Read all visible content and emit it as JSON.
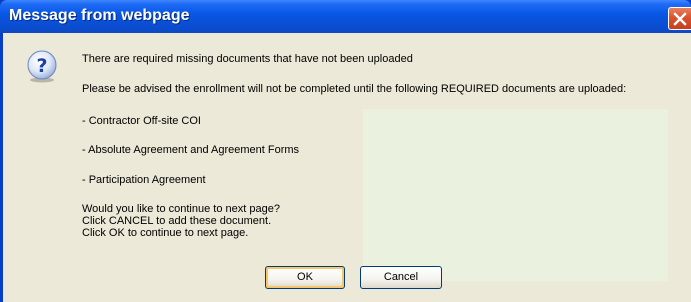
{
  "window": {
    "title": "Message from webpage",
    "close_icon": "close-icon"
  },
  "dialog": {
    "icon": "question-icon",
    "line1": "There are required missing documents that have not been uploaded",
    "line2": "Please be advised the enrollment will not be completed until the following REQUIRED documents are uploaded:",
    "documents": [
      "- Contractor Off-site COI",
      "- Absolute Agreement and Agreement Forms",
      "- Participation Agreement"
    ],
    "prompt": [
      "Would you like to continue to next page?",
      "Click CANCEL to add these document.",
      "Click OK to continue to next page."
    ]
  },
  "buttons": {
    "ok_label": "OK",
    "cancel_label": "Cancel"
  },
  "colors": {
    "titlebar": "#0858e6",
    "client_background": "#ece9d8",
    "panel_background": "#eaf2df",
    "close_button": "#d9532f"
  }
}
